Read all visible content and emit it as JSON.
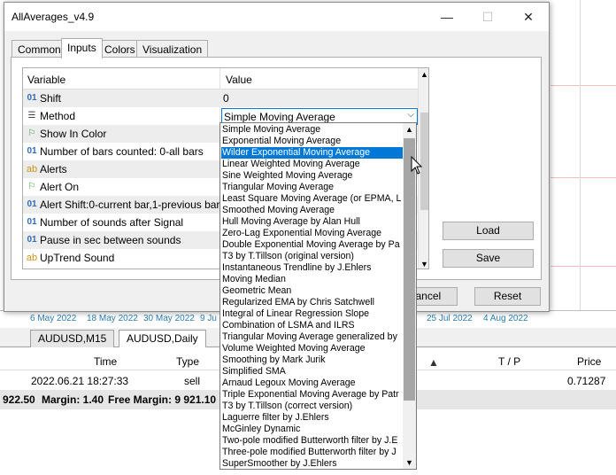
{
  "terminal": {
    "dates": [
      "6 May 2022",
      "18 May 2022",
      "30 May 2022",
      "9 Ju",
      "25 Jul 2022",
      "4 Aug 2022"
    ],
    "chart_tabs": [
      "AUDUSD,M15",
      "AUDUSD,Daily"
    ],
    "trade_columns": {
      "time": "Time",
      "type": "Type",
      "tp": "T / P",
      "price": "Price"
    },
    "trade_row": {
      "time": "2022.06.21 18:27:33",
      "type": "sell",
      "price": "0.71287"
    },
    "balance": {
      "amount": "922.50",
      "margin": "Margin: 1.40",
      "free_margin": "Free Margin: 9 921.10"
    }
  },
  "dialog": {
    "title": "AllAverages_v4.9",
    "tabs": [
      "Common",
      "Inputs",
      "Colors",
      "Visualization"
    ],
    "active_tab": "Inputs",
    "grid_headers": {
      "variable": "Variable",
      "value": "Value"
    },
    "rows": [
      {
        "icon": "01",
        "name": "Shift",
        "value": "0"
      },
      {
        "icon": "list",
        "name": "Method",
        "value": "Simple Moving Average"
      },
      {
        "icon": "flag",
        "name": "Show In Color",
        "value": ""
      },
      {
        "icon": "01",
        "name": "Number of bars counted: 0-all bars",
        "value": ""
      },
      {
        "icon": "ab",
        "name": "Alerts",
        "value": ""
      },
      {
        "icon": "flag",
        "name": "Alert On",
        "value": ""
      },
      {
        "icon": "01",
        "name": "Alert Shift:0-current bar,1-previous bar",
        "value": ""
      },
      {
        "icon": "01",
        "name": "Number of sounds after Signal",
        "value": ""
      },
      {
        "icon": "01",
        "name": "Pause in sec between sounds",
        "value": ""
      },
      {
        "icon": "ab",
        "name": "UpTrend Sound",
        "value": ""
      }
    ],
    "buttons": {
      "load": "Load",
      "save": "Save",
      "cancel": "Cancel",
      "reset": "Reset"
    }
  },
  "method_dropdown": {
    "selected": "Wilder Exponential Moving Average",
    "options": [
      "Simple Moving Average",
      "Exponential Moving Average",
      "Wilder Exponential Moving Average",
      "Linear Weighted Moving Average",
      "Sine Weighted Moving Average",
      "Triangular Moving Average",
      "Least Square Moving Average (or EPMA, L",
      "Smoothed Moving Average",
      "Hull Moving Average by Alan Hull",
      "Zero-Lag Exponential Moving Average",
      "Double Exponential Moving Average by Pa",
      "T3 by T.Tillson (original version)",
      "Instantaneous Trendline by J.Ehlers",
      "Moving Median",
      "Geometric Mean",
      "Regularized EMA by Chris Satchwell",
      "Integral of Linear Regression Slope",
      "Combination of LSMA and ILRS",
      "Triangular Moving Average generalized by",
      "Volume Weighted Moving Average",
      "Smoothing by Mark Jurik",
      "Simplified SMA",
      "Arnaud Legoux Moving Average",
      "Triple Exponential Moving Average by Patr",
      "T3 by T.Tillson (correct version)",
      "Laguerre filter by J.Ehlers",
      "McGinley Dynamic",
      "Two-pole modified Butterworth filter by J.E",
      "Three-pole modified Butterworth filter by J",
      "SuperSmoother by J.Ehlers"
    ]
  }
}
